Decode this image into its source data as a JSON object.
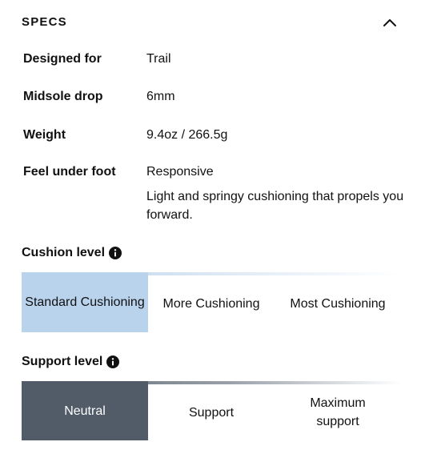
{
  "specs": {
    "title": "SPECS",
    "rows": [
      {
        "label": "Designed for",
        "value": "Trail"
      },
      {
        "label": "Midsole drop",
        "value": "6mm"
      },
      {
        "label": "Weight",
        "value": "9.4oz / 266.5g"
      },
      {
        "label": "Feel under foot",
        "value": "Responsive",
        "description": "Light and springy cushioning that propels you forward."
      }
    ]
  },
  "cushion_level": {
    "heading": "Cushion level",
    "icon": "info-icon",
    "options": [
      "Standard Cushioning",
      "More Cushioning",
      "Most Cushioning"
    ],
    "selected": "Standard Cushioning",
    "active_color": "#b9d3ec"
  },
  "support_level": {
    "heading": "Support level",
    "icon": "info-icon",
    "options": [
      "Neutral",
      "Support",
      "Maximum support"
    ],
    "selected": "Neutral",
    "active_color": "#525c69"
  },
  "icons": {
    "collapse": "chevron-up-icon"
  }
}
